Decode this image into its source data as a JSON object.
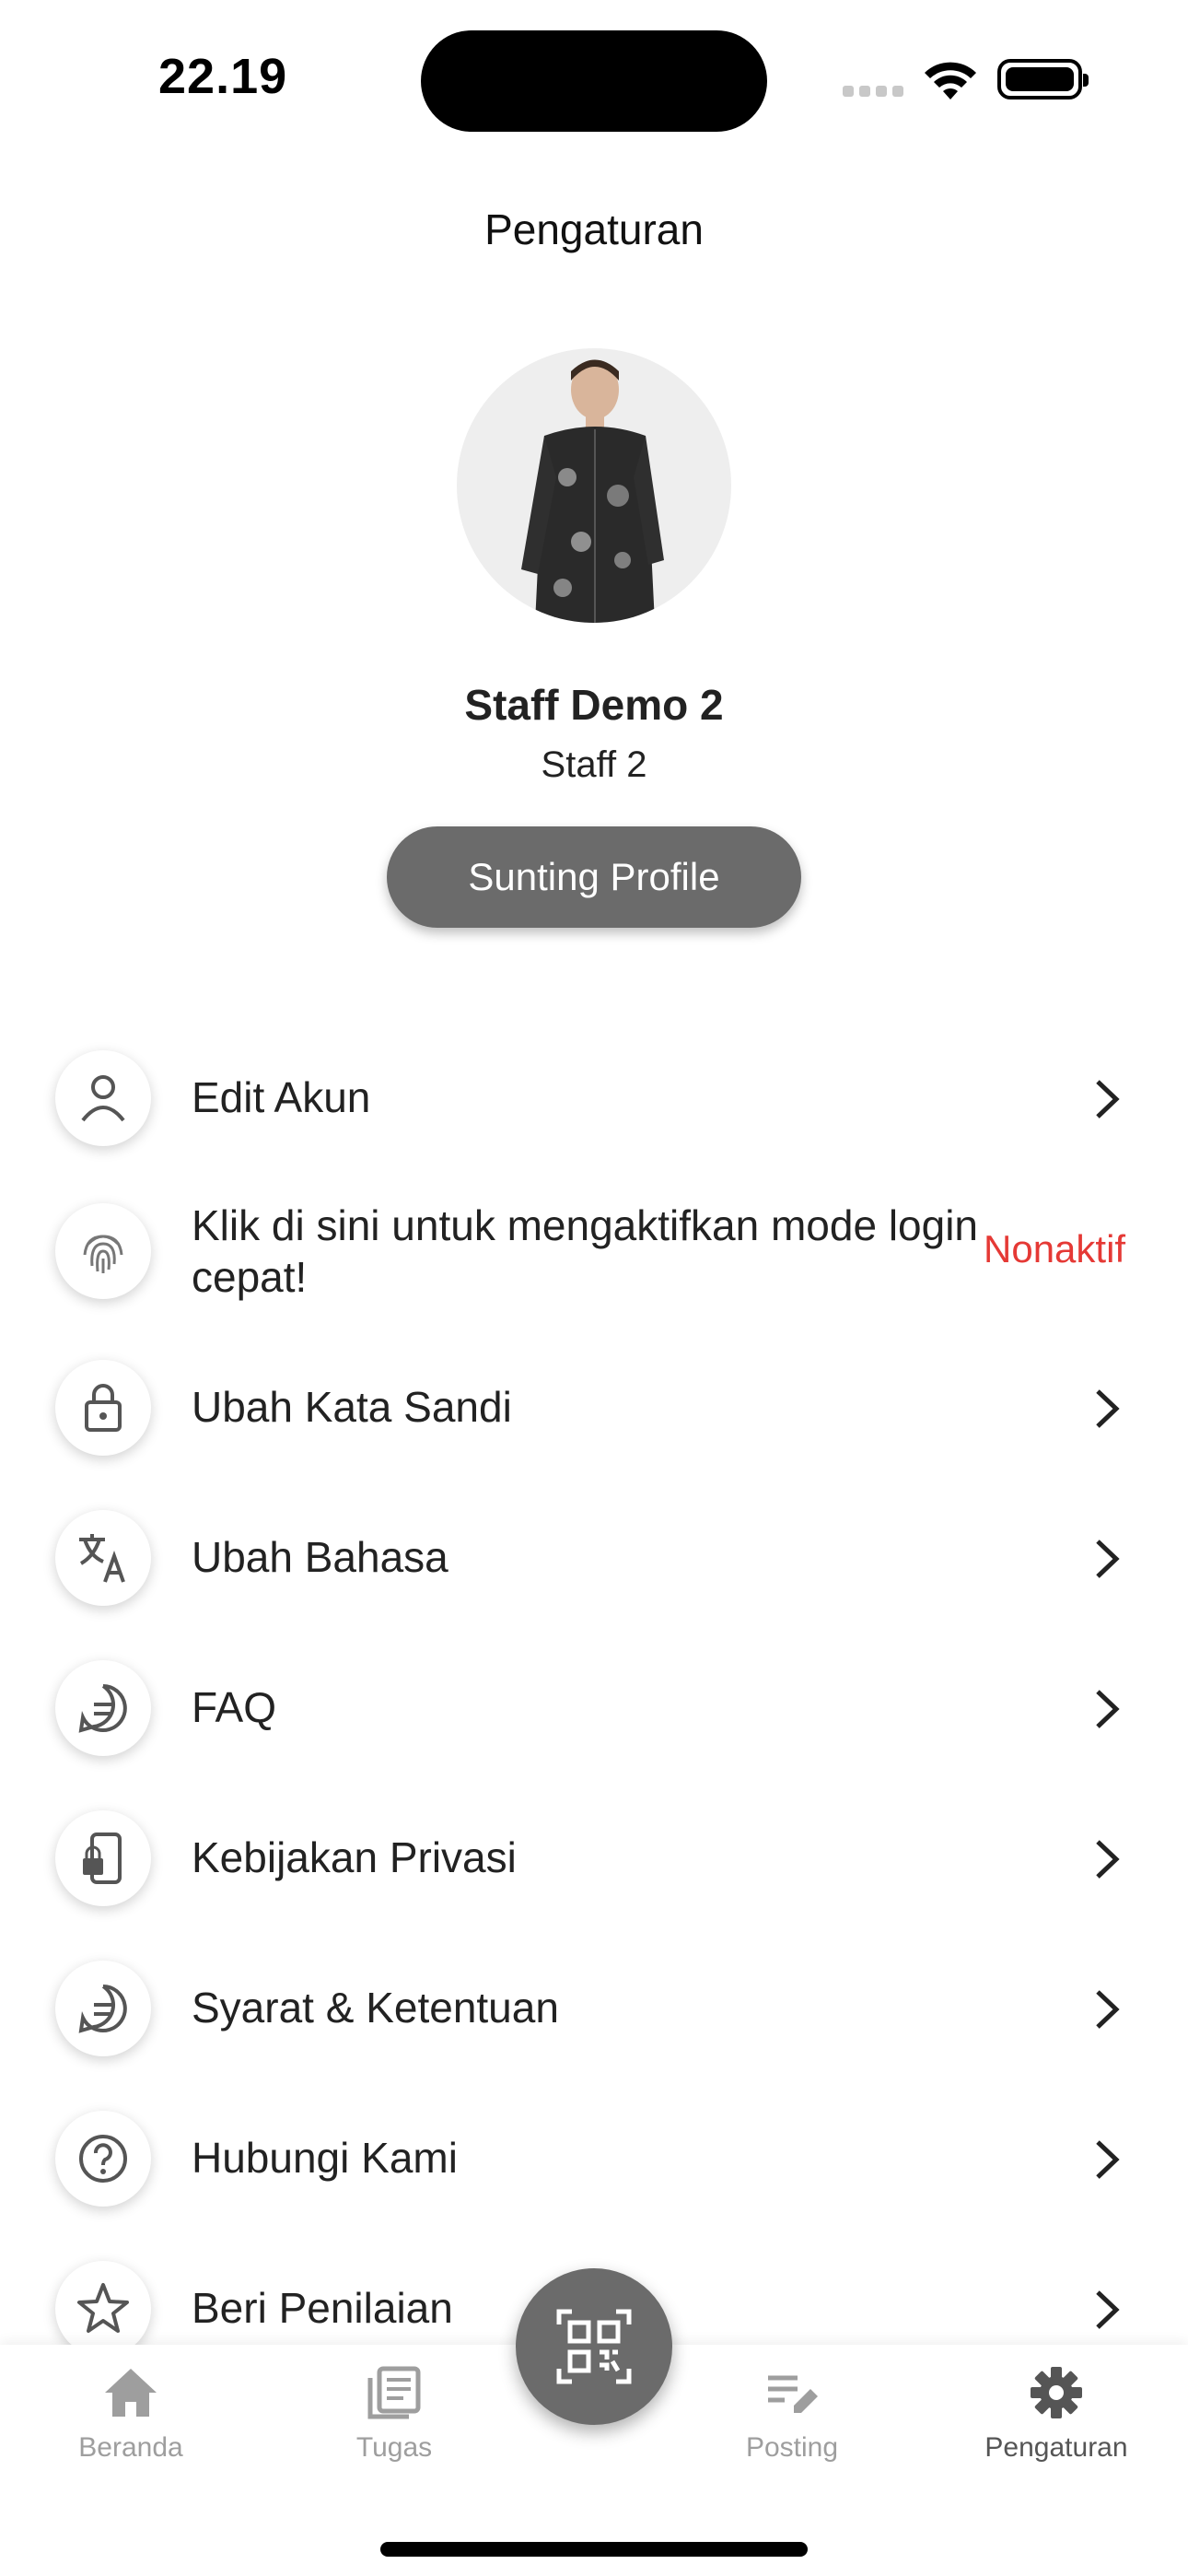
{
  "status_bar": {
    "time": "22.19"
  },
  "header": {
    "title": "Pengaturan"
  },
  "profile": {
    "name": "Staff Demo 2",
    "role": "Staff 2",
    "edit_button": "Sunting Profile"
  },
  "menu": {
    "items": [
      {
        "label": "Edit Akun",
        "icon": "person-icon"
      },
      {
        "label": "Klik di sini untuk mengaktifkan mode login cepat!",
        "icon": "fingerprint-icon",
        "status": "Nonaktif"
      },
      {
        "label": "Ubah Kata Sandi",
        "icon": "lock-icon"
      },
      {
        "label": "Ubah Bahasa",
        "icon": "translate-icon"
      },
      {
        "label": "FAQ",
        "icon": "faq-icon"
      },
      {
        "label": "Kebijakan Privasi",
        "icon": "phone-lock-icon"
      },
      {
        "label": "Syarat & Ketentuan",
        "icon": "terms-icon"
      },
      {
        "label": "Hubungi Kami",
        "icon": "help-circle-icon"
      },
      {
        "label": "Beri Penilaian",
        "icon": "star-icon"
      }
    ]
  },
  "bottom_nav": {
    "items": [
      {
        "label": "Beranda",
        "icon": "home-icon"
      },
      {
        "label": "Tugas",
        "icon": "news-icon"
      },
      {
        "label": "Posting",
        "icon": "edit-note-icon"
      },
      {
        "label": "Pengaturan",
        "icon": "gear-icon",
        "active": true
      }
    ],
    "center_button_icon": "qr-code-icon"
  },
  "colors": {
    "accent_gray": "#6b6b6b",
    "status_off": "#e53935",
    "nav_inactive": "#9e9e9e"
  }
}
